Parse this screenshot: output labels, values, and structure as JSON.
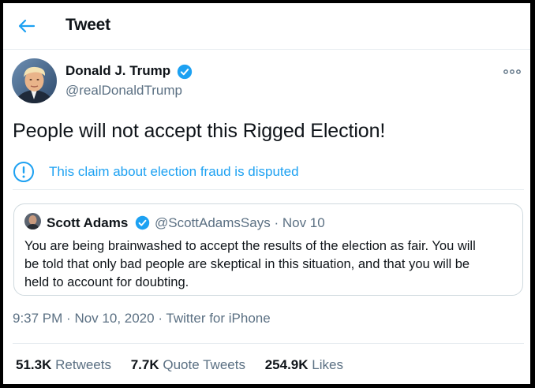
{
  "header": {
    "title": "Tweet",
    "back_icon": "arrow-left-icon"
  },
  "tweet": {
    "author": {
      "name": "Donald J. Trump",
      "handle": "@realDonaldTrump",
      "verified": true,
      "verified_icon": "verified-badge-icon"
    },
    "more_icon": "more-options-icon",
    "text": "People will not accept this Rigged Election!",
    "notice": {
      "icon": "exclamation-circle-icon",
      "text": "This claim about election fraud is disputed"
    },
    "quoted": {
      "author_name": "Scott Adams",
      "verified": true,
      "handle": "@ScottAdamsSays",
      "separator": "·",
      "date": "Nov 10",
      "text_lines": [
        "You are being brainwashed to accept the results of the election as fair. You will",
        "be told that only bad people are skeptical in this situation, and that you will be",
        "held to account for doubting."
      ]
    },
    "time": "9:37 PM",
    "date": "Nov 10, 2020",
    "separator": "·",
    "source": "Twitter for iPhone",
    "stats": {
      "retweets_count": "51.3K",
      "retweets_label": "Retweets",
      "quotes_count": "7.7K",
      "quotes_label": "Quote Tweets",
      "likes_count": "254.9K",
      "likes_label": "Likes"
    }
  },
  "colors": {
    "accent": "#1da1f2",
    "text_primary": "#0f1419",
    "text_secondary": "#5b7083",
    "border": "#e6ecf0"
  }
}
